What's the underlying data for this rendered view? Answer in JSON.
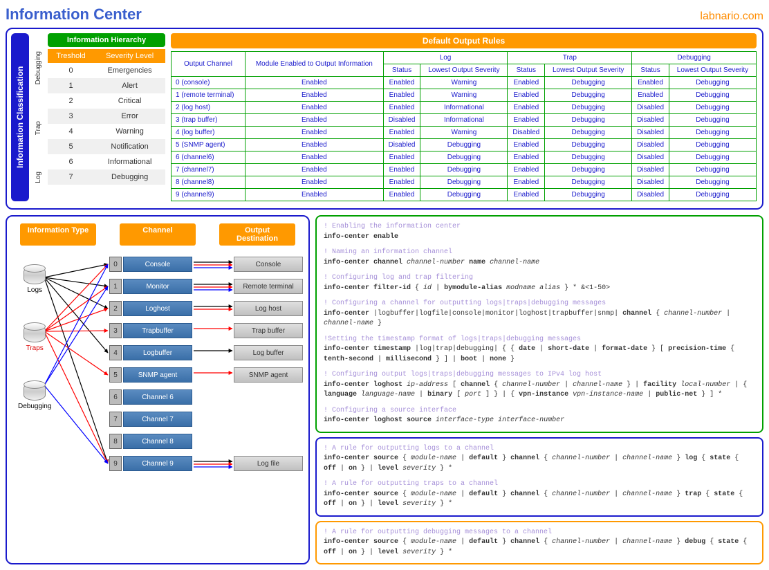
{
  "header": {
    "title": "Information Center",
    "brand": "labnario.com"
  },
  "classification_label": "Information Classification",
  "type_rail": [
    "Debugging",
    "Trap",
    "Log"
  ],
  "hierarchy": {
    "title": "Information Hierarchy",
    "cols": [
      "Treshold",
      "Severity Level"
    ],
    "rows": [
      {
        "t": "0",
        "s": "Emergencies"
      },
      {
        "t": "1",
        "s": "Alert"
      },
      {
        "t": "2",
        "s": "Critical"
      },
      {
        "t": "3",
        "s": "Error"
      },
      {
        "t": "4",
        "s": "Warning"
      },
      {
        "t": "5",
        "s": "Notification"
      },
      {
        "t": "6",
        "s": "Informational"
      },
      {
        "t": "7",
        "s": "Debugging"
      }
    ]
  },
  "rules": {
    "title": "Default Output Rules",
    "head1": {
      "oc": "Output Channel",
      "me": "Module Enabled to Output Information",
      "log": "Log",
      "trap": "Trap",
      "dbg": "Debugging"
    },
    "head2": {
      "st": "Status",
      "los": "Lowest Output Severity"
    },
    "rows": [
      {
        "c": "0 (console)",
        "m": "Enabled",
        "ls": "Enabled",
        "ll": "Warning",
        "ts": "Enabled",
        "tl": "Debugging",
        "ds": "Enabled",
        "dl": "Debugging"
      },
      {
        "c": "1 (remote terminal)",
        "m": "Enabled",
        "ls": "Enabled",
        "ll": "Warning",
        "ts": "Enabled",
        "tl": "Debugging",
        "ds": "Enabled",
        "dl": "Debugging"
      },
      {
        "c": "2 (log host)",
        "m": "Enabled",
        "ls": "Enabled",
        "ll": "Informational",
        "ts": "Enabled",
        "tl": "Debugging",
        "ds": "Disabled",
        "dl": "Debugging"
      },
      {
        "c": "3 (trap buffer)",
        "m": "Enabled",
        "ls": "Disabled",
        "ll": "Informational",
        "ts": "Enabled",
        "tl": "Debugging",
        "ds": "Disabled",
        "dl": "Debugging"
      },
      {
        "c": "4 (log buffer)",
        "m": "Enabled",
        "ls": "Enabled",
        "ll": "Warning",
        "ts": "Disabled",
        "tl": "Debugging",
        "ds": "Disabled",
        "dl": "Debugging"
      },
      {
        "c": "5 (SNMP agent)",
        "m": "Enabled",
        "ls": "Disabled",
        "ll": "Debugging",
        "ts": "Enabled",
        "tl": "Debugging",
        "ds": "Disabled",
        "dl": "Debugging"
      },
      {
        "c": "6 (channel6)",
        "m": "Enabled",
        "ls": "Enabled",
        "ll": "Debugging",
        "ts": "Enabled",
        "tl": "Debugging",
        "ds": "Disabled",
        "dl": "Debugging"
      },
      {
        "c": "7 (channel7)",
        "m": "Enabled",
        "ls": "Enabled",
        "ll": "Debugging",
        "ts": "Enabled",
        "tl": "Debugging",
        "ds": "Disabled",
        "dl": "Debugging"
      },
      {
        "c": "8 (channel8)",
        "m": "Enabled",
        "ls": "Enabled",
        "ll": "Debugging",
        "ts": "Enabled",
        "tl": "Debugging",
        "ds": "Disabled",
        "dl": "Debugging"
      },
      {
        "c": "9 (channel9)",
        "m": "Enabled",
        "ls": "Enabled",
        "ll": "Debugging",
        "ts": "Enabled",
        "tl": "Debugging",
        "ds": "Disabled",
        "dl": "Debugging"
      }
    ]
  },
  "flow": {
    "cols": [
      "Information Type",
      "Channel",
      "Output Destination"
    ],
    "sources": [
      {
        "name": "Logs",
        "color": "#000"
      },
      {
        "name": "Traps",
        "color": "#d00"
      },
      {
        "name": "Debugging",
        "color": "#000"
      }
    ],
    "channels": [
      {
        "n": "0",
        "name": "Console",
        "dest": "Console"
      },
      {
        "n": "1",
        "name": "Monitor",
        "dest": "Remote terminal"
      },
      {
        "n": "2",
        "name": "Loghost",
        "dest": "Log host"
      },
      {
        "n": "3",
        "name": "Trapbuffer",
        "dest": "Trap buffer"
      },
      {
        "n": "4",
        "name": "Logbuffer",
        "dest": "Log buffer"
      },
      {
        "n": "5",
        "name": "SNMP agent",
        "dest": "SNMP agent"
      },
      {
        "n": "6",
        "name": "Channel 6",
        "dest": ""
      },
      {
        "n": "7",
        "name": "Channel 7",
        "dest": ""
      },
      {
        "n": "8",
        "name": "Channel 8",
        "dest": ""
      },
      {
        "n": "9",
        "name": "Channel 9",
        "dest": "Log file"
      }
    ]
  },
  "cmds": {
    "green": [
      {
        "c": "! Enabling the information center",
        "l": "<b>info-center enable</b>"
      },
      {
        "c": "! Naming an information channel",
        "l": "<b>info-center channel</b> <i>channel-number</i> <b>name</b> <i>channel-name</i>"
      },
      {
        "c": "! Configuring log and trap filtering",
        "l": "<b>info-center filter-id</b> { <i>id</i> | <b>bymodule-alias</b> <i>modname alias</i> } * &amp;&lt;1-50&gt;"
      },
      {
        "c": "! Configuring a channel for outputting logs|traps|debugging messages",
        "l": "<b>info-center</b> |logbuffer|logfile|console|monitor|loghost|trapbuffer|snmp| <b>channel</b> { <i>channel-number</i> | <i>channel-name</i> }"
      },
      {
        "c": "!Setting the timestamp format of logs|traps|debugging messages",
        "l": "<b>info-center timestamp</b> |log|trap|debugging| { { <b>date</b> | <b>short-date</b> | <b>format-date</b> } [ <b>precision-time</b> { <b>tenth-second</b> | <b>millisecond</b> } ] | <b>boot</b> | <b>none</b> }"
      },
      {
        "c": "! Configuring output logs|traps|debugging messages to IPv4 log host",
        "l": "<b>info-center loghost</b> <i>ip-address</i> [ <b>channel</b> { <i>channel-number</i> | <i>channel-name</i> } | <b>facility</b> <i>local-number</i> | { <b>language</b> <i>language-name</i> | <b>binary</b> [ <i>port</i> ] } | { <b>vpn-instance</b> <i>vpn-instance-name</i> | <b>public-net</b> } ] *"
      },
      {
        "c": "! Configuring a source interface",
        "l": "<b>info-center loghost source</b> <i>interface-type interface-number</i>"
      }
    ],
    "blue": [
      {
        "c": "! A rule for outputting logs to a channel",
        "l": "<b>info-center source</b> { <i>module-name</i> | <b>default</b> } <b>channel</b> { <i>channel-number</i> | <i>channel-name</i> } <b>log</b> { <b>state</b> { <b>off</b> | <b>on</b> } | <b>level</b> <i>severity</i> } *"
      },
      {
        "c": "! A rule for outputting traps to a channel",
        "l": "<b>info-center source</b> { <i>module-name</i> | <b>default</b> } <b>channel</b> { <i>channel-number</i> | <i>channel-name</i> } <b>trap</b> { <b>state</b> { <b>off</b> | <b>on</b> } | <b>level</b> <i>severity</i> } *"
      }
    ],
    "orange": [
      {
        "c": "! A rule for outputting debugging messages to a channel",
        "l": "<b>info-center source</b> { <i>module-name</i> | <b>default</b> } <b>channel</b> { <i>channel-number</i> | <i>channel-name</i> } <b>debug</b> { <b>state</b> { <b>off</b> | <b>on</b> } | <b>level</b> <i>severity</i> } *"
      }
    ]
  }
}
